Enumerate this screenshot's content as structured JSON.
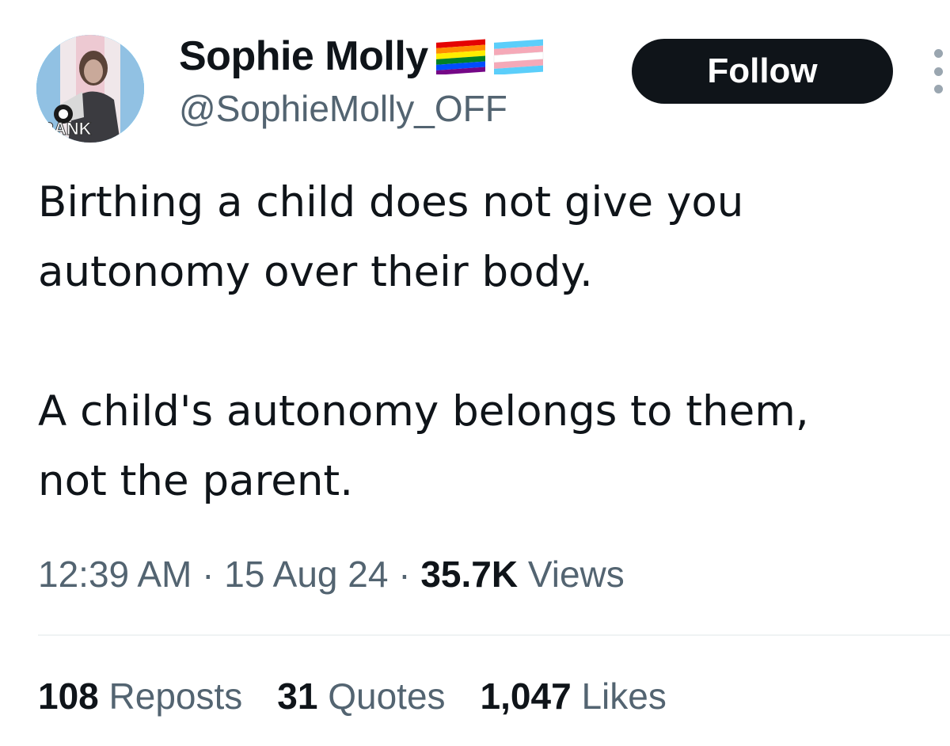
{
  "author": {
    "display_name": "Sophie Molly",
    "handle": "@SophieMolly_OFF",
    "name_emojis": [
      "rainbow-flag-icon",
      "transgender-flag-icon"
    ],
    "avatar_text": "RANK"
  },
  "follow_button": {
    "label": "Follow"
  },
  "tweet": {
    "paragraph_1": "Birthing a child does not give you\nautonomy over their body.",
    "paragraph_2": "A child's autonomy belongs to them,\nnot the parent."
  },
  "meta": {
    "time": "12:39 AM",
    "separator": " · ",
    "date": "15 Aug 24",
    "views_count": "35.7K",
    "views_label": "Views"
  },
  "stats": {
    "reposts_count": "108",
    "reposts_label": "Reposts",
    "quotes_count": "31",
    "quotes_label": "Quotes",
    "likes_count": "1,047",
    "likes_label": "Likes"
  },
  "colors": {
    "text_primary": "#0f1419",
    "text_secondary": "#536471",
    "button_bg": "#0f1419",
    "divider": "#eff3f4",
    "trans_blue": "#5bcefa",
    "trans_pink": "#f5a9b8"
  }
}
